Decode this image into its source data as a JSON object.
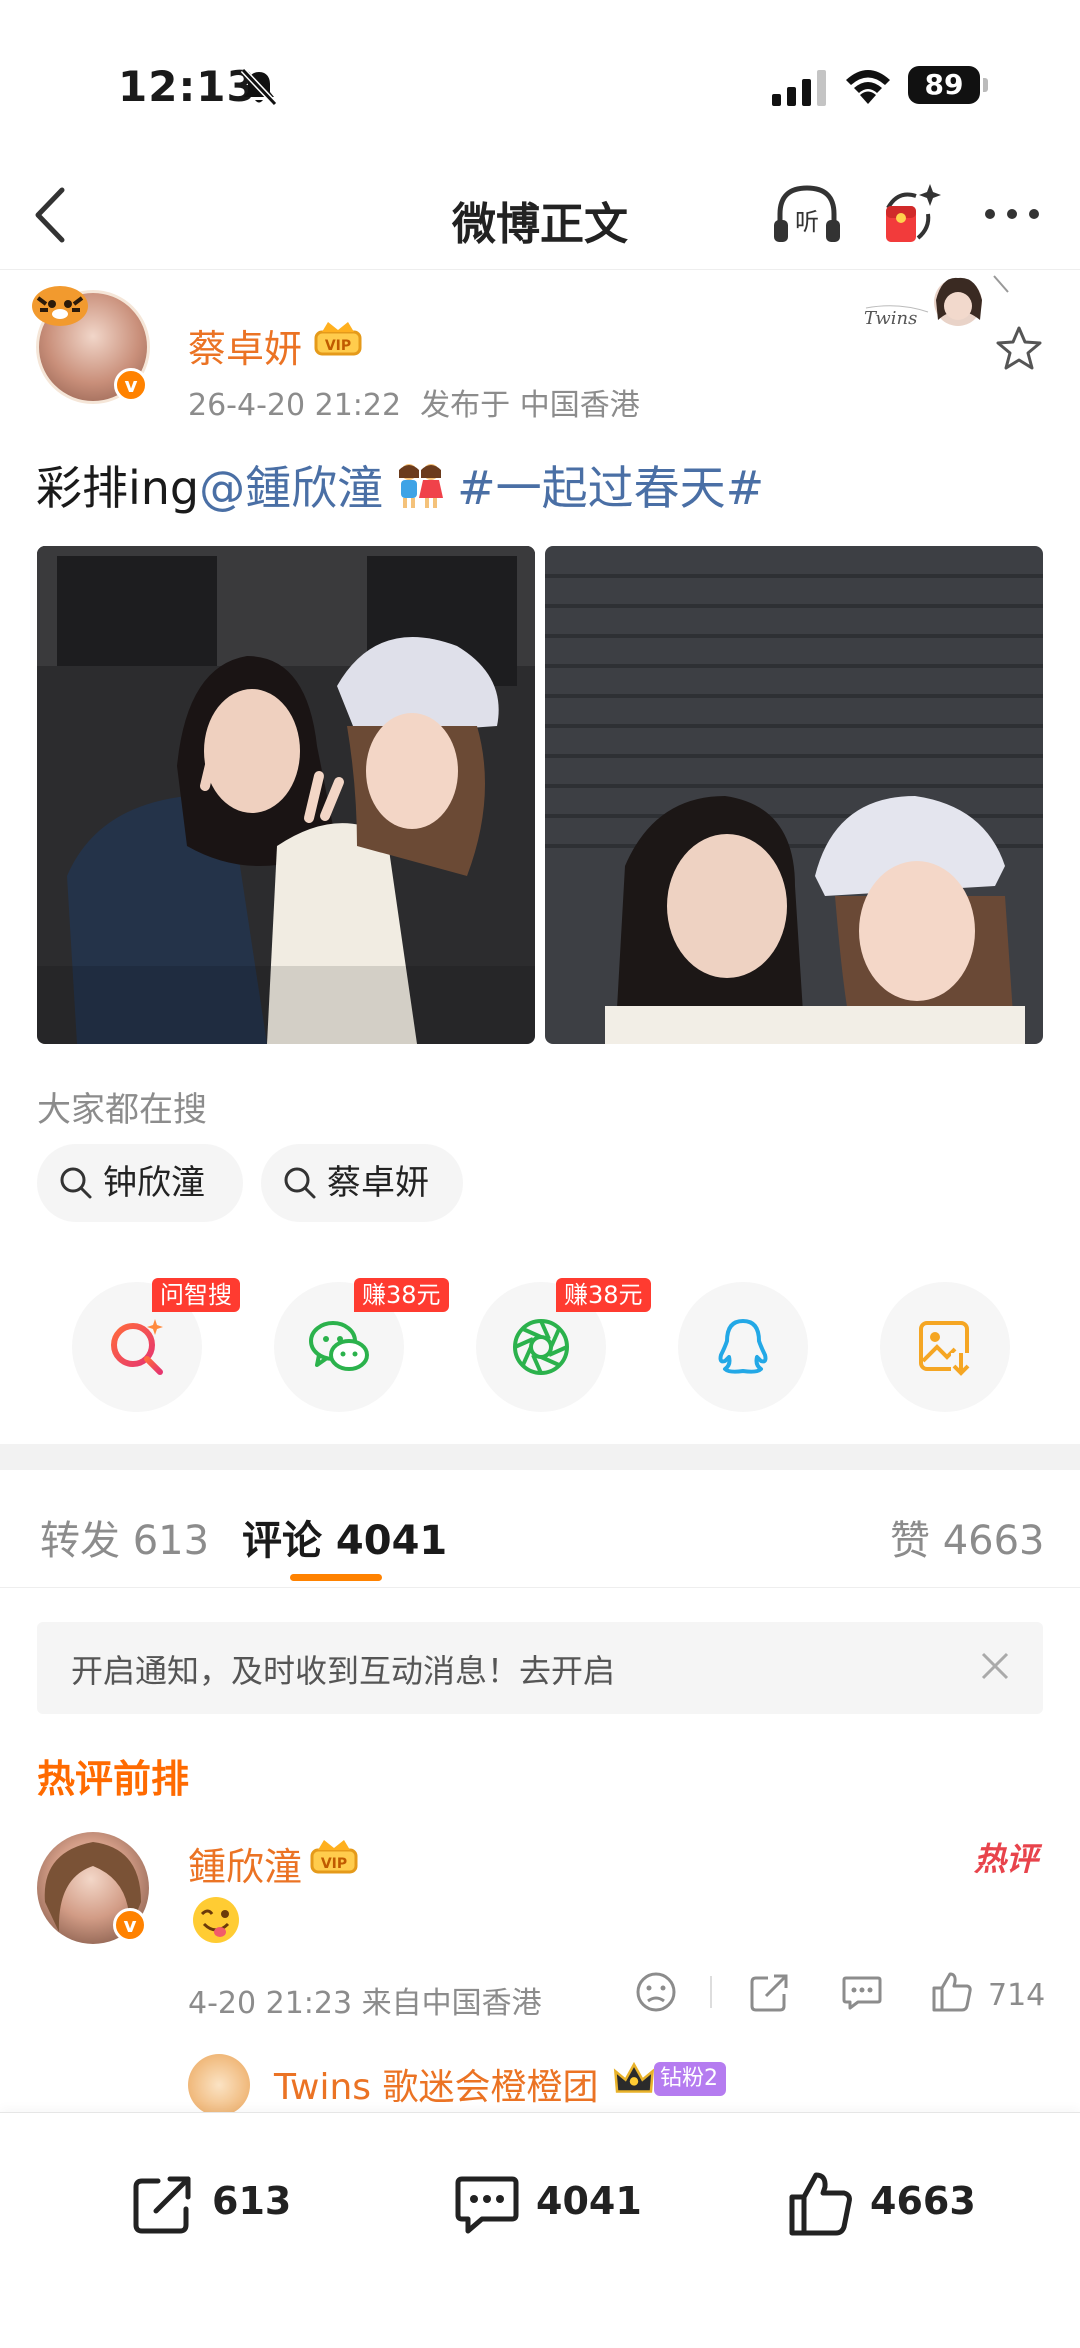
{
  "status_bar": {
    "time": "12:13",
    "battery": "89"
  },
  "nav": {
    "title": "微博正文",
    "listen_label": "听"
  },
  "post": {
    "author": "蔡卓妍",
    "timestamp": "26-4-20 21:22",
    "location": "发布于 中国香港",
    "text_prefix": "彩排ing",
    "mention": "@鍾欣潼",
    "topic": "#一起过春天#",
    "twins_badge_text": "Twins"
  },
  "search": {
    "label": "大家都在搜",
    "chips": [
      "钟欣潼",
      "蔡卓妍"
    ]
  },
  "share_tags": {
    "zhisou": "问智搜",
    "wechat": "赚38元",
    "moments": "赚38元"
  },
  "tabs": {
    "repost": "转发 613",
    "comment": "评论 4041",
    "like": "赞 4663"
  },
  "notice": {
    "text": "开启通知，及时收到互动消息！去开启"
  },
  "hot_comments": {
    "title": "热评前排",
    "comment": {
      "author": "鍾欣潼",
      "hot_tag": "热评",
      "meta": "4-20 21:23 来自中国香港",
      "likes": "714"
    },
    "reply": {
      "author": "Twins 歌迷会橙橙团",
      "fan_tag": "钻粉2"
    }
  },
  "bottom_bar": {
    "repost_count": "613",
    "comment_count": "4041",
    "like_count": "4663"
  },
  "colors": {
    "accent": "#ff8200",
    "name_orange": "#eb7324",
    "link_blue": "#4a6fa5",
    "hot_red": "#e8434b"
  }
}
